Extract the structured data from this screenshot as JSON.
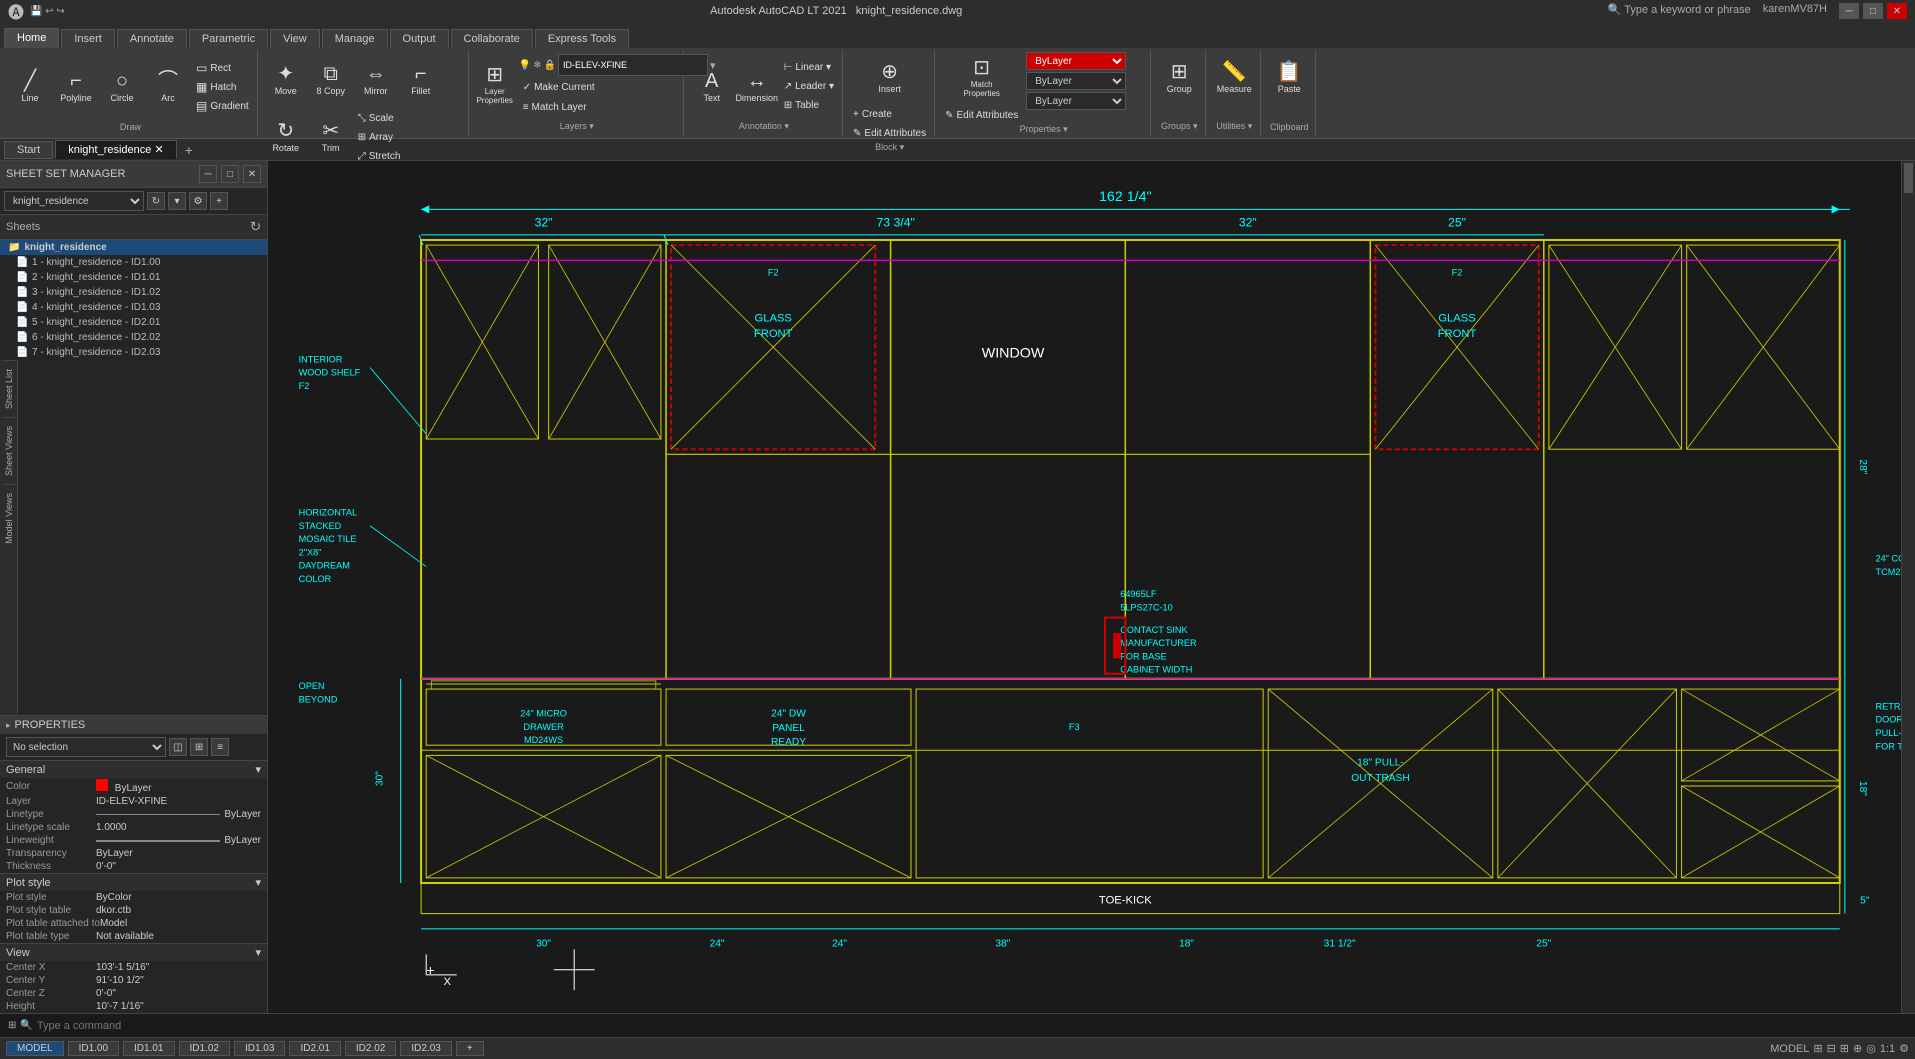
{
  "titlebar": {
    "app_name": "Autodesk AutoCAD LT 2021",
    "file_name": "knight_residence.dwg",
    "search_placeholder": "Type a keyword or phrase",
    "user": "karenMV87H"
  },
  "ribbon": {
    "tabs": [
      "Home",
      "Insert",
      "Annotate",
      "Parametric",
      "View",
      "Manage",
      "Output",
      "Collaborate",
      "Express Tools"
    ],
    "active_tab": "Home",
    "groups": {
      "draw": {
        "label": "Draw",
        "items": [
          "Line",
          "Polyline",
          "Circle",
          "Arc"
        ]
      },
      "modify": {
        "label": "Modify",
        "items": [
          "Move",
          "Copy",
          "Mirror",
          "Fillet",
          "Rotate",
          "Trim",
          "Scale",
          "Array",
          "Stretch"
        ]
      },
      "layers": {
        "label": "Layers",
        "layer_name": "ID-ELEV-XFINE",
        "items": [
          "Layer Properties",
          "Make Current",
          "Match Layer"
        ]
      },
      "annotation": {
        "label": "Annotation",
        "items": [
          "Text",
          "Dimension",
          "Linear",
          "Leader",
          "Table"
        ]
      },
      "block": {
        "label": "Block",
        "items": [
          "Insert",
          "Create",
          "Edit Attributes"
        ]
      },
      "properties": {
        "label": "Properties",
        "items": [
          "Match Properties",
          "Edit Attributes"
        ],
        "bylayer": "ByLayer"
      },
      "groups_panel": {
        "label": "Groups",
        "items": [
          "Group"
        ]
      },
      "utilities": {
        "label": "Utilities",
        "items": [
          "Measure"
        ]
      },
      "clipboard": {
        "label": "Clipboard",
        "items": [
          "Paste"
        ]
      }
    }
  },
  "tabs": {
    "items": [
      "Start",
      "knight_residence",
      "+"
    ],
    "active": "knight_residence"
  },
  "ssm": {
    "title": "SHEET SET MANAGER",
    "dropdown_value": "knight_residence",
    "sheets_label": "Sheets",
    "sheets": [
      {
        "label": "knight_residence",
        "type": "parent",
        "selected": true
      },
      {
        "label": "1 - knight_residence - ID1.00",
        "indent": 1
      },
      {
        "label": "2 - knight_residence - ID1.01",
        "indent": 1
      },
      {
        "label": "3 - knight_residence - ID1.02",
        "indent": 1
      },
      {
        "label": "4 - knight_residence - ID1.03",
        "indent": 1
      },
      {
        "label": "5 - knight_residence - ID2.01",
        "indent": 1
      },
      {
        "label": "6 - knight_residence - ID2.02",
        "indent": 1
      },
      {
        "label": "7 - knight_residence - ID2.03",
        "indent": 1
      }
    ],
    "side_tabs": [
      "Sheet List",
      "Sheet Views",
      "Model Views"
    ]
  },
  "properties": {
    "title": "PROPERTIES",
    "selection": "No selection",
    "general_section": "General",
    "plot_style_section": "Plot style",
    "view_section": "View",
    "fields": {
      "color": "ByLayer",
      "layer": "ID-ELEV-XFINE",
      "linetype": "ByLayer",
      "linetype_scale": "1.0000",
      "lineweight": "ByLayer",
      "transparency": "ByLayer",
      "thickness": "0'-0\"",
      "plot_style": "ByColor",
      "plot_style_table": "dkor.ctb",
      "plot_table_attached": "Model",
      "plot_table_type": "Not available",
      "center_x": "103'-1 5/16\"",
      "center_y": "91'-10 1/2\"",
      "center_z": "0'-0\"",
      "height": "10'-7 1/16\""
    }
  },
  "command_bar": {
    "placeholder": "Type a command"
  },
  "status_bar": {
    "model_tab": "MODEL",
    "id100": "ID1.00",
    "id101": "ID1.01",
    "id102": "ID1.02",
    "id103": "ID1.03",
    "id201": "ID2.01",
    "id202": "ID2.02",
    "id203": "ID2.03",
    "scale": "1:1"
  }
}
